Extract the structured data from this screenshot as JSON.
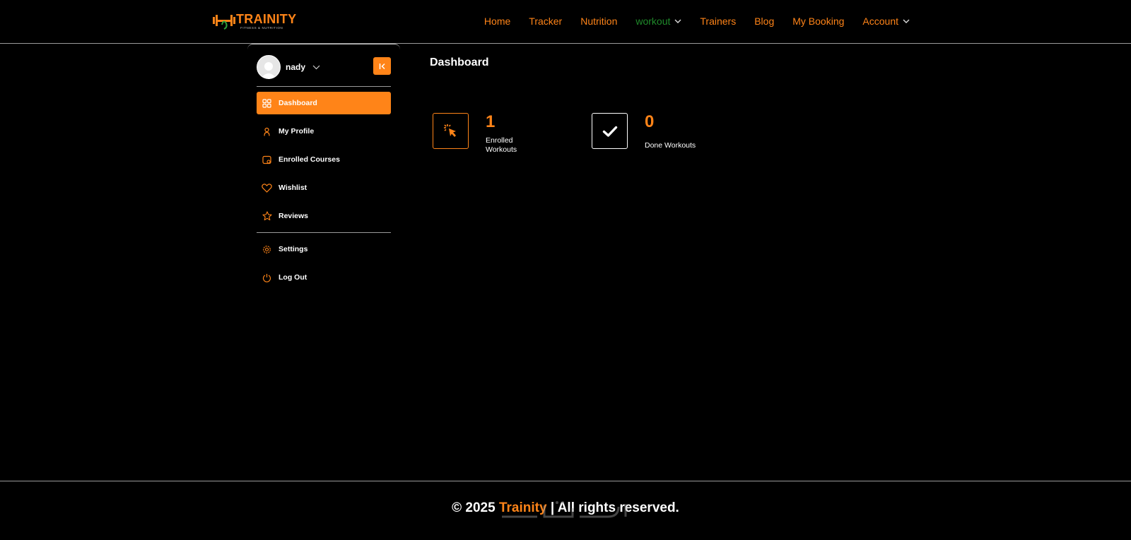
{
  "header": {
    "logo_text": "TRAINITY",
    "logo_sub": "FITNESS & NUTRITION",
    "nav": [
      {
        "label": "Home",
        "dropdown": false,
        "active": false
      },
      {
        "label": "Tracker",
        "dropdown": false,
        "active": false
      },
      {
        "label": "Nutrition",
        "dropdown": false,
        "active": false
      },
      {
        "label": "workout",
        "dropdown": true,
        "active": true
      },
      {
        "label": "Trainers",
        "dropdown": false,
        "active": false
      },
      {
        "label": "Blog",
        "dropdown": false,
        "active": false
      },
      {
        "label": "My Booking",
        "dropdown": false,
        "active": false
      },
      {
        "label": "Account",
        "dropdown": true,
        "active": false
      }
    ]
  },
  "sidebar": {
    "user_name": "nady",
    "items": [
      {
        "label": "Dashboard",
        "icon": "grid-icon",
        "active": true
      },
      {
        "label": "My Profile",
        "icon": "user-icon",
        "active": false
      },
      {
        "label": "Enrolled Courses",
        "icon": "course-icon",
        "active": false
      },
      {
        "label": "Wishlist",
        "icon": "heart-icon",
        "active": false
      },
      {
        "label": "Reviews",
        "icon": "star-icon",
        "active": false
      }
    ],
    "bottom_items": [
      {
        "label": "Settings",
        "icon": "gear-icon"
      },
      {
        "label": "Log Out",
        "icon": "power-icon"
      }
    ]
  },
  "main": {
    "title": "Dashboard",
    "stats": [
      {
        "value": "1",
        "label": "Enrolled Workouts",
        "icon": "cursor-click-icon"
      },
      {
        "value": "0",
        "label": "Done Workouts",
        "icon": "check-icon"
      }
    ]
  },
  "footer": {
    "prefix": "© 2025 ",
    "brand": "Trainity",
    "suffix": " | All rights reserved."
  },
  "colors": {
    "accent": "#ff8418",
    "active_nav": "#1f8a2a",
    "background": "#000000"
  }
}
